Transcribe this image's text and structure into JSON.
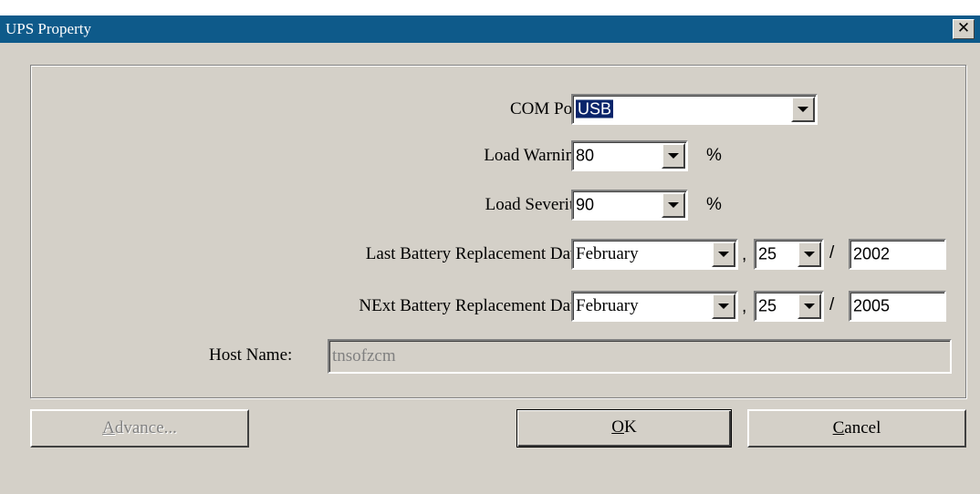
{
  "window": {
    "title": "UPS Property",
    "close_symbol": "✕"
  },
  "fields": {
    "com_port": {
      "label": "COM Port:",
      "value": "USB"
    },
    "load_warning": {
      "label": "Load Warning:",
      "value": "80",
      "unit": "%"
    },
    "load_severity": {
      "label": "Load Severity:",
      "value": "90",
      "unit": "%"
    },
    "last_battery": {
      "label": "Last Battery Replacement Date:",
      "month": "February",
      "comma": ",",
      "day": "25",
      "slash": "/",
      "year": "2002"
    },
    "next_battery": {
      "label": "NExt Battery Replacement Date:",
      "month": "February",
      "comma": ",",
      "day": "25",
      "slash": "/",
      "year": "2005"
    },
    "host_name": {
      "label": "Host Name:",
      "value": "tnsofzcm"
    }
  },
  "buttons": {
    "advance": {
      "mnemonic": "A",
      "rest": "dvance..."
    },
    "ok": {
      "mnemonic": "O",
      "rest": "K"
    },
    "cancel": {
      "mnemonic": "C",
      "rest": "ancel"
    }
  },
  "icons": {
    "dropdown": "chevron-down-icon",
    "close": "close-icon"
  }
}
